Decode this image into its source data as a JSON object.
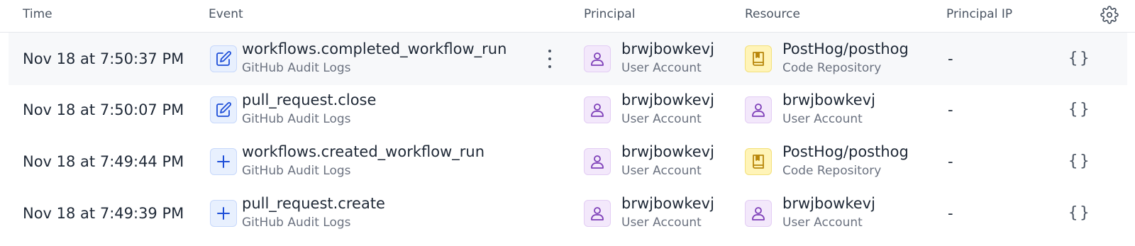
{
  "header": {
    "time": "Time",
    "event": "Event",
    "principal": "Principal",
    "resource": "Resource",
    "principal_ip": "Principal IP",
    "settings_icon": "gear-icon"
  },
  "rows": [
    {
      "time": "Nov 18 at 7:50:37 PM",
      "event_icon": "edit-icon",
      "event_name": "workflows.completed_workflow_run",
      "event_source": "GitHub Audit Logs",
      "principal_name": "brwjbowkevj",
      "principal_type": "User Account",
      "resource_icon": "repo-icon",
      "resource_name": "PostHog/posthog",
      "resource_type": "Code Repository",
      "ip": "-",
      "json_label": "{}"
    },
    {
      "time": "Nov 18 at 7:50:07 PM",
      "event_icon": "edit-icon",
      "event_name": "pull_request.close",
      "event_source": "GitHub Audit Logs",
      "principal_name": "brwjbowkevj",
      "principal_type": "User Account",
      "resource_icon": "user-icon",
      "resource_name": "brwjbowkevj",
      "resource_type": "User Account",
      "ip": "-",
      "json_label": "{}"
    },
    {
      "time": "Nov 18 at 7:49:44 PM",
      "event_icon": "plus-icon",
      "event_name": "workflows.created_workflow_run",
      "event_source": "GitHub Audit Logs",
      "principal_name": "brwjbowkevj",
      "principal_type": "User Account",
      "resource_icon": "repo-icon",
      "resource_name": "PostHog/posthog",
      "resource_type": "Code Repository",
      "ip": "-",
      "json_label": "{}"
    },
    {
      "time": "Nov 18 at 7:49:39 PM",
      "event_icon": "plus-icon",
      "event_name": "pull_request.create",
      "event_source": "GitHub Audit Logs",
      "principal_name": "brwjbowkevj",
      "principal_type": "User Account",
      "resource_icon": "user-icon",
      "resource_name": "brwjbowkevj",
      "resource_type": "User Account",
      "ip": "-",
      "json_label": "{}"
    }
  ],
  "colors": {
    "accent_blue": "#1d4ed8",
    "user_purple": "#7e3fb8",
    "repo_yellow": "#b8860b",
    "hover_row": "#f7f8fa"
  }
}
